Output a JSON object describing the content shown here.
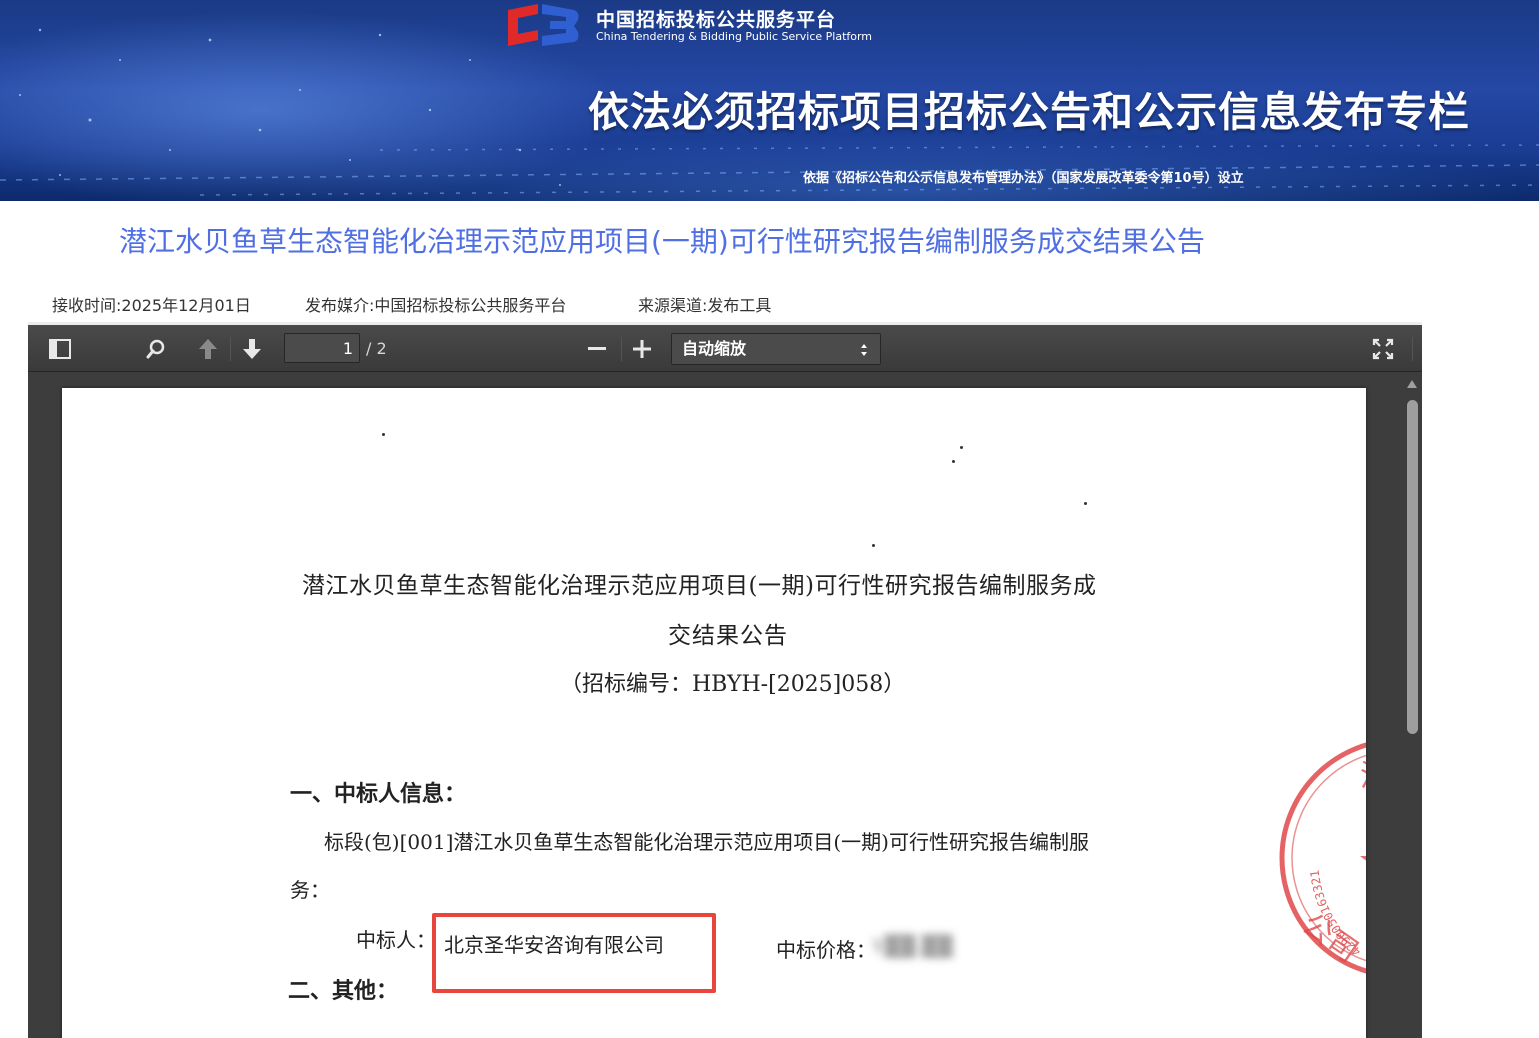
{
  "banner": {
    "platform_name_cn": "中国招标投标公共服务平台",
    "platform_name_en": "China Tendering & Bidding Public Service Platform",
    "title": "依法必须招标项目招标公告和公示信息发布专栏",
    "subtitle": "依据《招标公告和公示信息发布管理办法》（国家发展改革委令第10号）设立"
  },
  "notice": {
    "title": "潜江水贝鱼草生态智能化治理示范应用项目(一期)可行性研究报告编制服务成交结果公告",
    "receive_time": "接收时间:2025年12月01日",
    "media": "发布媒介:中国招标投标公共服务平台",
    "source": "来源渠道:发布工具"
  },
  "viewer": {
    "toolbar": {
      "current_page": "1",
      "page_count": "/ 2",
      "zoom_label": "自动缩放",
      "zoom_arrows": "▲▼"
    },
    "document": {
      "title_line1": "潜江水贝鱼草生态智能化治理示范应用项目(一期)可行性研究报告编制服务成",
      "title_line2": "交结果公告",
      "tender_code": "（招标编号：HBYH-[2025]058）",
      "section1_heading": "一、中标人信息：",
      "lot_text": "标段(包)[001]潜江水贝鱼草生态智能化治理示范应用项目(一期)可行性研究报告编制服",
      "lot_text_cont": "务：",
      "winner_label": "中标人：",
      "winner_name": "北京圣华安咨询有限公司",
      "price_label": "中标价格：",
      "price_value": "¥██.██",
      "section2_heading": "二、其他："
    },
    "seal": {
      "serial": "4290050163321",
      "text_top": "潜",
      "text_bottom": "公司"
    }
  },
  "colors": {
    "banner_blue": "#2448a4",
    "title_link": "#4f6fe3",
    "viewer_bg": "#3d3d3d",
    "highlight_red": "#e8453c",
    "seal_red": "#e0484a"
  }
}
